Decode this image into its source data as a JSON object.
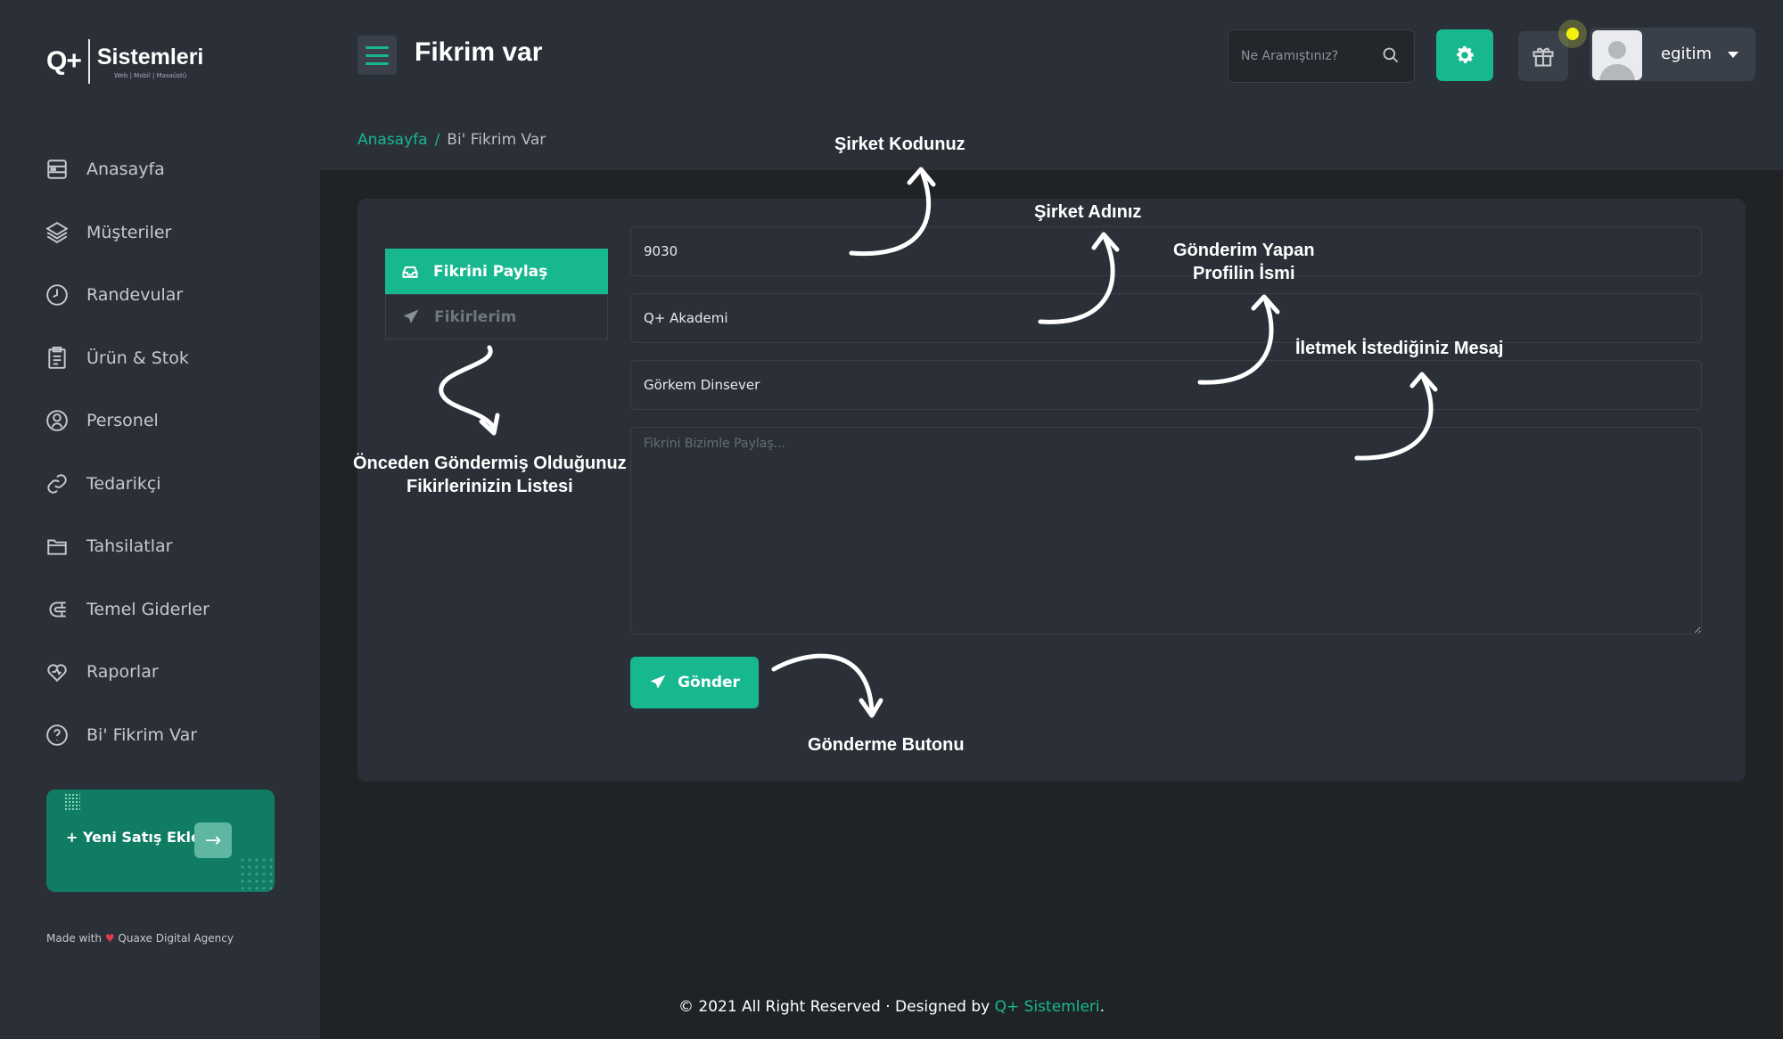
{
  "sidebar": {
    "logo_mark": "Q+",
    "logo_name": "Sistemleri",
    "logo_sub": "Web | Mobil | Masaüstü",
    "items": [
      {
        "label": "Anasayfa",
        "icon": "dashboard-icon"
      },
      {
        "label": "Müşteriler",
        "icon": "layers-icon"
      },
      {
        "label": "Randevular",
        "icon": "clock-icon"
      },
      {
        "label": "Ürün & Stok",
        "icon": "clipboard-icon"
      },
      {
        "label": "Personel",
        "icon": "user-circle-icon"
      },
      {
        "label": "Tedarikçi",
        "icon": "link-icon"
      },
      {
        "label": "Tahsilatlar",
        "icon": "folder-icon"
      },
      {
        "label": "Temel Giderler",
        "icon": "magnet-icon"
      },
      {
        "label": "Raporlar",
        "icon": "heart-icon"
      },
      {
        "label": "Bi' Fikrim Var",
        "icon": "help-circle-icon"
      }
    ],
    "promo_label": "+ Yeni Satış Ekle",
    "promo_arrow": "→",
    "made_prefix": "Made with",
    "made_heart": "♥",
    "made_suffix": "Quaxe Digital Agency"
  },
  "header": {
    "title": "Fikrim var",
    "search_placeholder": "Ne Aramıştınız?",
    "username": "egitim"
  },
  "breadcrumb": {
    "home": "Anasayfa",
    "separator": "/",
    "current": "Bi' Fikrim Var"
  },
  "tabs": [
    {
      "label": "Fikrini Paylaş",
      "active": true
    },
    {
      "label": "Fikirlerim",
      "active": false
    }
  ],
  "form": {
    "company_code": "9030",
    "company_name": "Q+ Akademi",
    "sender_name": "Görkem Dinsever",
    "message_placeholder": "Fikrini Bizimle Paylaş...",
    "send_label": "Gönder"
  },
  "annotations": {
    "company_code": "Şirket Kodunuz",
    "company_name": "Şirket Adınız",
    "sender_line1": "Gönderim Yapan",
    "sender_line2": "Profilin İsmi",
    "message": "İletmek İstediğiniz Mesaj",
    "list_line1": "Önceden Göndermiş Olduğunuz",
    "list_line2": "Fikirlerinizin Listesi",
    "send": "Gönderme Butonu"
  },
  "footer": {
    "text": "© 2021 All Right Reserved · Designed by ",
    "brand": "Q+ Sistemleri",
    "end": "."
  },
  "colors": {
    "accent": "#17b890",
    "background": "#1f2326",
    "panel": "#2b3038",
    "notification": "#f4f10e"
  }
}
